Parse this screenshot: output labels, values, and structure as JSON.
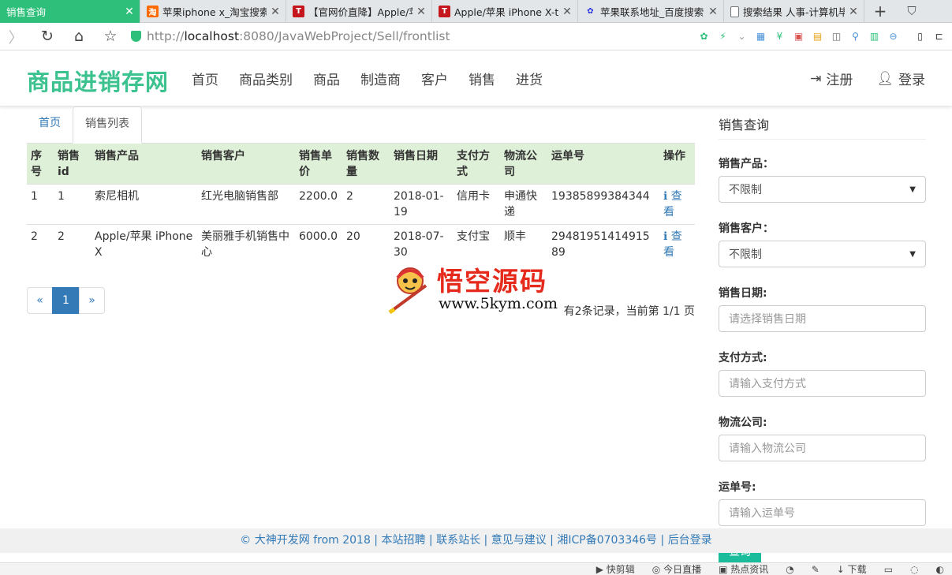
{
  "browser": {
    "tabs": [
      {
        "title": "销售查询",
        "favicon": "page",
        "active": true
      },
      {
        "title": "苹果iphone x_淘宝搜索",
        "favicon": "taobao",
        "active": false
      },
      {
        "title": "【官网价直降】Apple/苹",
        "favicon": "tmall",
        "active": false
      },
      {
        "title": "Apple/苹果 iPhone X-t",
        "favicon": "tmall",
        "active": false
      },
      {
        "title": "苹果联系地址_百度搜索",
        "favicon": "baidu",
        "active": false
      },
      {
        "title": "搜索结果 人事-计算机毕",
        "favicon": "doc",
        "active": false
      }
    ],
    "favicon_text": {
      "taobao": "淘",
      "tmall": "T",
      "baidu": "✿"
    },
    "url_prefix": "http://",
    "url_host": "localhost",
    "url_rest": ":8080/JavaWebProject/Sell/frontlist",
    "accent": "#2ec07a"
  },
  "site": {
    "brand": "商品进销存网",
    "brand_color": "#3cc28f",
    "nav": [
      "首页",
      "商品类别",
      "商品",
      "制造商",
      "客户",
      "销售",
      "进货"
    ],
    "register": "注册",
    "login": "登录"
  },
  "main": {
    "tabs": [
      "首页",
      "销售列表"
    ],
    "table": {
      "headers": [
        "序号",
        "销售id",
        "销售产品",
        "销售客户",
        "销售单价",
        "销售数量",
        "销售日期",
        "支付方式",
        "物流公司",
        "运单号",
        "操作"
      ],
      "rows": [
        [
          "1",
          "1",
          "索尼相机",
          "红光电脑销售部",
          "2200.0",
          "2",
          "2018-01-19",
          "信用卡",
          "申通快递",
          "19385899384344",
          "查看"
        ],
        [
          "2",
          "2",
          "Apple/苹果 iPhone X",
          "美丽雅手机销售中心",
          "6000.0",
          "20",
          "2018-07-30",
          "支付宝",
          "顺丰",
          "2948195141491589",
          "查看"
        ]
      ]
    },
    "pagination": {
      "prev": "«",
      "current": "1",
      "next": "»"
    },
    "record_info": "有2条记录，当前第 1/1 页"
  },
  "watermark": {
    "cn": "悟空源码",
    "en": "www.5kym.com"
  },
  "sidebar": {
    "title": "销售查询",
    "product_label": "销售产品：",
    "product_value": "不限制",
    "customer_label": "销售客户：",
    "customer_value": "不限制",
    "date_label": "销售日期:",
    "date_placeholder": "请选择销售日期",
    "pay_label": "支付方式:",
    "pay_placeholder": "请输入支付方式",
    "logistics_label": "物流公司:",
    "logistics_placeholder": "请输入物流公司",
    "waybill_label": "运单号:",
    "waybill_placeholder": "请输入运单号",
    "submit": "查询",
    "button_color": "#1abc9c"
  },
  "footer": {
    "links": [
      "© 大神开发网 from 2018",
      "本站招聘",
      "联系站长",
      "意见与建议",
      "湘ICP备0703346号",
      "后台登录"
    ]
  },
  "statusbar": [
    "快剪辑",
    "今日直播",
    "热点资讯",
    "",
    "",
    "下载",
    "",
    "",
    ""
  ]
}
